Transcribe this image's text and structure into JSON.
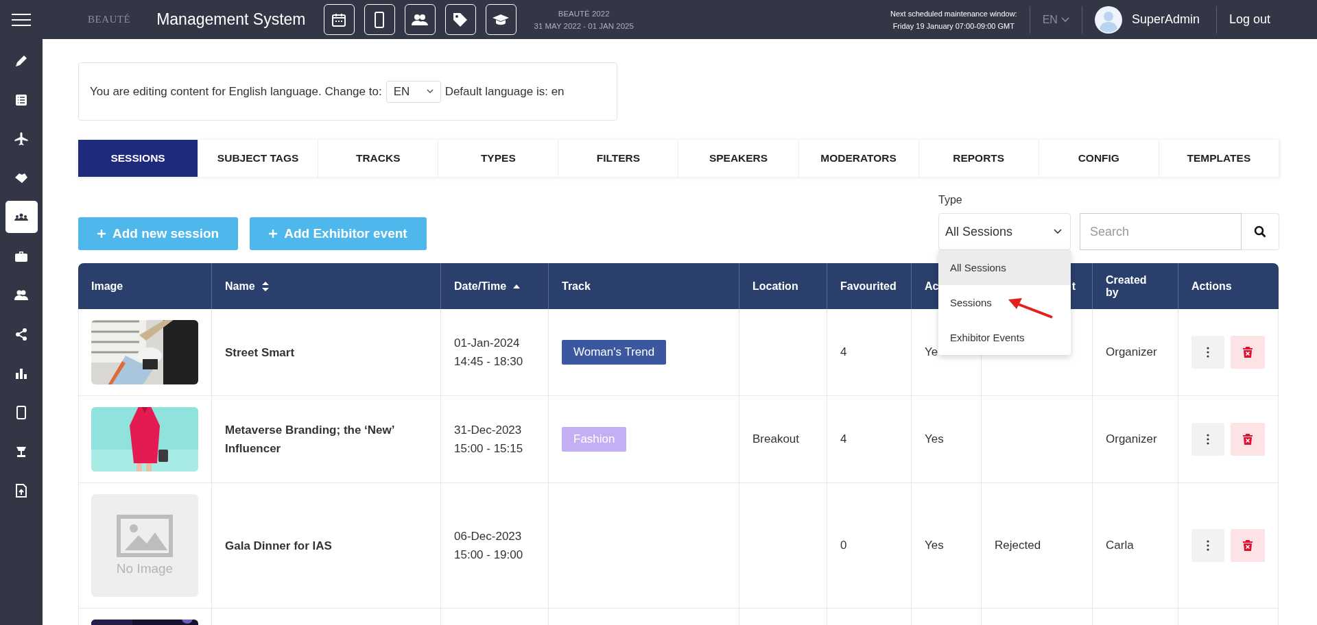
{
  "topbar": {
    "logo": "BEAUTÉ",
    "title": "Management System",
    "event_name": "BEAUTÉ 2022",
    "event_dates": "31 MAY 2022 - 01 JAN 2025",
    "maintenance_title": "Next scheduled maintenance window:",
    "maintenance_time": "Friday 19 January 07:00-09:00 GMT",
    "language": "EN",
    "user": "SuperAdmin",
    "logout": "Log out"
  },
  "sidebar": {
    "items": [
      {
        "selected": false
      },
      {
        "selected": false
      },
      {
        "selected": false
      },
      {
        "selected": false
      },
      {
        "selected": true
      },
      {
        "selected": false
      },
      {
        "selected": false
      },
      {
        "selected": false
      },
      {
        "selected": false
      },
      {
        "selected": false
      },
      {
        "selected": false
      },
      {
        "selected": false
      }
    ]
  },
  "notice": {
    "text": "You are editing content for English language. Change to:",
    "language": "EN",
    "default_text": "Default language is: en"
  },
  "tabs": [
    {
      "label": "SESSIONS",
      "selected": true
    },
    {
      "label": "SUBJECT TAGS",
      "selected": false
    },
    {
      "label": "TRACKS",
      "selected": false
    },
    {
      "label": "TYPES",
      "selected": false
    },
    {
      "label": "FILTERS",
      "selected": false
    },
    {
      "label": "SPEAKERS",
      "selected": false
    },
    {
      "label": "MODERATORS",
      "selected": false
    },
    {
      "label": "REPORTS",
      "selected": false
    },
    {
      "label": "CONFIG",
      "selected": false
    },
    {
      "label": "TEMPLATES",
      "selected": false
    }
  ],
  "actions": [
    "Add new session",
    "Add Exhibitor event"
  ],
  "type_filter": {
    "label": "Type",
    "value": "All Sessions",
    "options": [
      {
        "label": "All Sessions",
        "selected": true
      },
      {
        "label": "Sessions",
        "selected": false
      },
      {
        "label": "Exhibitor Events",
        "selected": false
      }
    ]
  },
  "search": {
    "placeholder": "Search"
  },
  "table": {
    "columns": [
      {
        "label": "Image"
      },
      {
        "label": "Name",
        "sortable": true,
        "sorted": false
      },
      {
        "label": "Date/Time",
        "sortable": true,
        "sorted": true
      },
      {
        "label": "Track"
      },
      {
        "label": "Location"
      },
      {
        "label": "Favourited"
      },
      {
        "label": "Ac"
      },
      {
        "label": "t"
      },
      {
        "label": "Created by"
      },
      {
        "label": "Actions"
      }
    ],
    "rows": [
      {
        "image": {
          "kind": "picture"
        },
        "name": "Street Smart",
        "date": "01-Jan-2024",
        "time": "14:45 - 18:30",
        "track": {
          "label": "Woman's Trend",
          "color": "#3a57a0"
        },
        "favourited": "4",
        "column_7": "Ye",
        "created_by": "Organizer"
      },
      {
        "image": {
          "kind": "picture"
        },
        "name": "Metaverse Branding; the ‘New’ Influencer",
        "date": "31-Dec-2023",
        "time": "15:00 - 15:15",
        "track": {
          "label": "Fashion",
          "color": "#c5aff4"
        },
        "location": "Breakout",
        "favourited": "4",
        "column_7": "Yes",
        "created_by": "Organizer"
      },
      {
        "image": {
          "kind": "placeholder",
          "text": "No Image"
        },
        "name": "Gala Dinner for IAS",
        "date": "06-Dec-2023",
        "time": "15:00 - 19:00",
        "favourited": "0",
        "column_7": "Yes",
        "column_8": "Rejected",
        "created_by": "Carla"
      },
      {
        "image": {
          "kind": "picture"
        }
      }
    ]
  }
}
